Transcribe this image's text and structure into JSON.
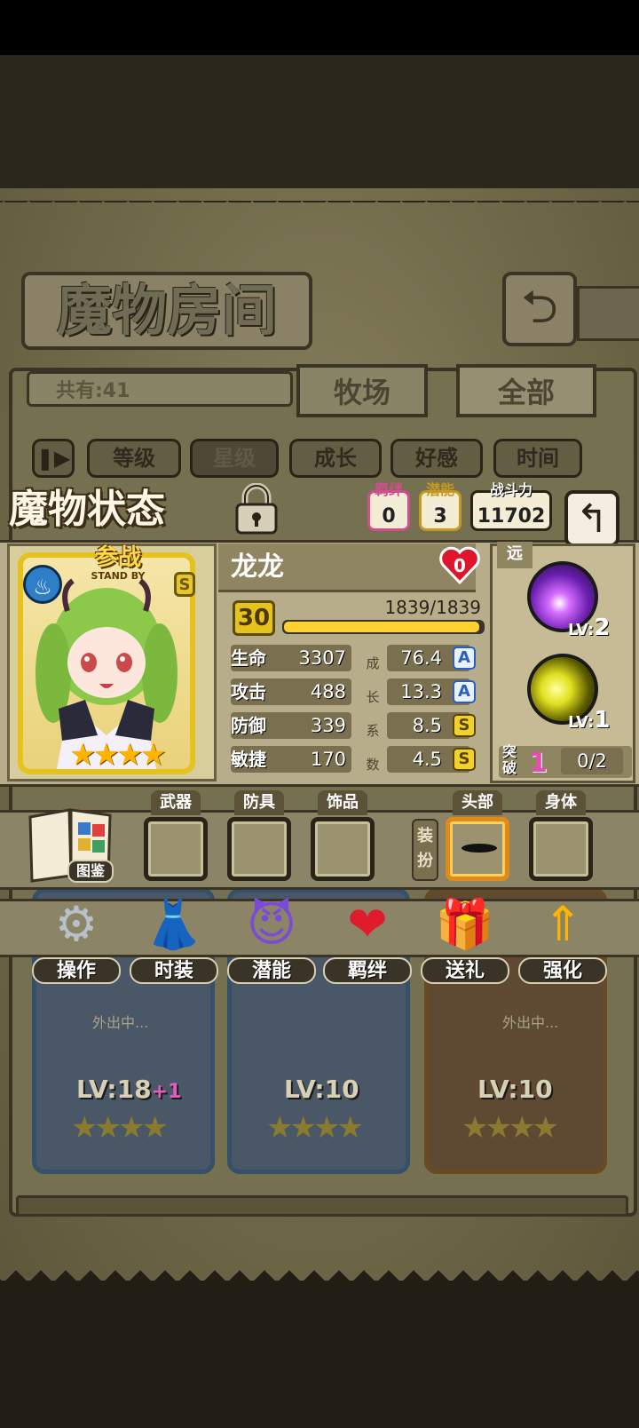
{
  "room": {
    "title": "魔物房间",
    "owned": "共有:41",
    "tabs": [
      "牧场",
      "全部"
    ],
    "sort_buttons": [
      "等级",
      "星级",
      "成长",
      "好感",
      "时间"
    ]
  },
  "cards": [
    {
      "status": "外出中...",
      "level": "LV:18",
      "bonus": "+1",
      "stars": "★★★★"
    },
    {
      "status": "",
      "level": "LV:10",
      "bonus": "",
      "stars": "★★★★"
    },
    {
      "status": "外出中...",
      "level": "LV:10",
      "bonus": "",
      "stars": "★★★★"
    }
  ],
  "status": {
    "header": "魔物状态",
    "bond_label": "羁绊",
    "bond_value": "0",
    "potential_label": "潜能",
    "potential_value": "3",
    "power_label": "战斗力",
    "power_value": "11702",
    "back_icon": "return-arrow-icon",
    "standby": "参战",
    "standby_sub": "STAND BY",
    "element": "water",
    "rank": "S",
    "portrait_stars": "★★★★",
    "name": "龙龙",
    "heart_value": "0",
    "level": "30",
    "exp_text": "1839/1839",
    "exp_fraction": 1.0,
    "stats": [
      {
        "name": "生命",
        "value": "3307",
        "growth": "76.4",
        "grade": "A"
      },
      {
        "name": "攻击",
        "value": "488",
        "growth": "13.3",
        "grade": "A"
      },
      {
        "name": "防御",
        "value": "339",
        "growth": "8.5",
        "grade": "S"
      },
      {
        "name": "敏捷",
        "value": "170",
        "growth": "4.5",
        "grade": "S"
      }
    ],
    "growth_caption": [
      "成",
      "长",
      "系",
      "数"
    ],
    "range": "远",
    "skills": [
      {
        "lv_prefix": "LV:",
        "lv": "2"
      },
      {
        "lv_prefix": "LV:",
        "lv": "1"
      }
    ],
    "breakthrough_label": "突破",
    "breakthrough_value": "1",
    "breakthrough_progress": "0/2"
  },
  "equipment": {
    "book_label": "图鉴",
    "slots": [
      "武器",
      "防具",
      "饰品"
    ],
    "dress_label": "装扮",
    "dress_slots": [
      "头部",
      "身体"
    ]
  },
  "actions": [
    {
      "label": "操作",
      "icon": "gear-icon"
    },
    {
      "label": "时装",
      "icon": "outfit-icon"
    },
    {
      "label": "潜能",
      "icon": "demon-icon"
    },
    {
      "label": "羁绊",
      "icon": "hearts-icon"
    },
    {
      "label": "送礼",
      "icon": "gift-icon"
    },
    {
      "label": "强化",
      "icon": "upgrade-arrows-icon"
    }
  ]
}
